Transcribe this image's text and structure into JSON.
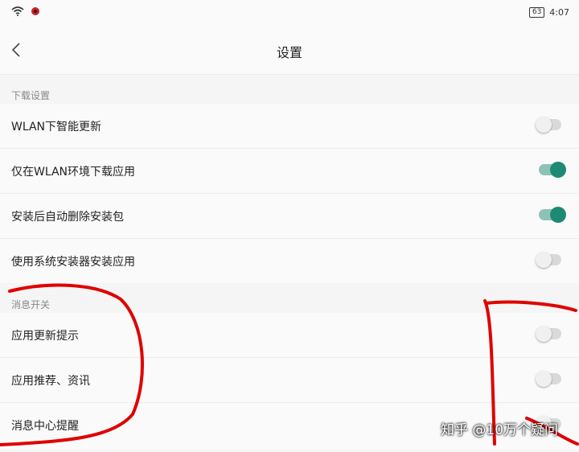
{
  "statusbar": {
    "time": "4:07",
    "battery": "63"
  },
  "header": {
    "title": "设置"
  },
  "sections": [
    {
      "title": "下载设置",
      "items": [
        {
          "label": "WLAN下智能更新",
          "on": false
        },
        {
          "label": "仅在WLAN环境下载应用",
          "on": true
        },
        {
          "label": "安装后自动删除安装包",
          "on": true
        },
        {
          "label": "使用系统安装器安装应用",
          "on": false
        }
      ]
    },
    {
      "title": "消息开关",
      "items": [
        {
          "label": "应用更新提示",
          "on": false
        },
        {
          "label": "应用推荐、资讯",
          "on": false
        },
        {
          "label": "消息中心提醒",
          "on": false
        }
      ]
    }
  ],
  "watermark": "知乎 @10万个疑问",
  "colors": {
    "accent": "#1f8a74",
    "annotation": "#e00000"
  }
}
